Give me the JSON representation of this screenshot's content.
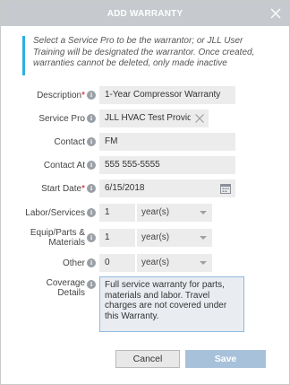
{
  "dialog": {
    "title": "ADD WARRANTY"
  },
  "notice": "Select a Service Pro to be the warrantor; or JLL User Training will be designated the warrantor. Once created, warranties cannot be deleted, only made inactive",
  "icons": {
    "close": "close-icon",
    "info": "info-icon",
    "clear": "clear-x-icon",
    "calendar": "calendar-icon",
    "caret": "chevron-down-icon"
  },
  "colors": {
    "accent_bar": "#2bb0e3",
    "required": "#d0021b",
    "titlebar": "#c6cacf",
    "save_button": "#a8c1db"
  },
  "form": {
    "description": {
      "label": "Description",
      "required_mark": "*",
      "value": "1-Year Compressor Warranty"
    },
    "service_pro": {
      "label": "Service Pro",
      "value": "JLL HVAC Test Provider"
    },
    "contact": {
      "label": "Contact",
      "value": "FM"
    },
    "contact_at": {
      "label": "Contact At",
      "value": "555 555-5555"
    },
    "start_date": {
      "label": "Start Date",
      "required_mark": "*",
      "value": "6/15/2018"
    },
    "labor_services": {
      "label": "Labor/Services",
      "value": "1",
      "unit": "year(s)"
    },
    "equip_parts": {
      "label": "Equip/Parts & Materials",
      "value": "1",
      "unit": "year(s)"
    },
    "other": {
      "label": "Other",
      "value": "0",
      "unit": "year(s)"
    },
    "coverage_details": {
      "label": "Coverage Details",
      "value": "Full service warranty for parts, materials and labor. Travel charges are not covered under this Warranty."
    },
    "info_glyph": "i"
  },
  "buttons": {
    "cancel": "Cancel",
    "save": "Save"
  }
}
